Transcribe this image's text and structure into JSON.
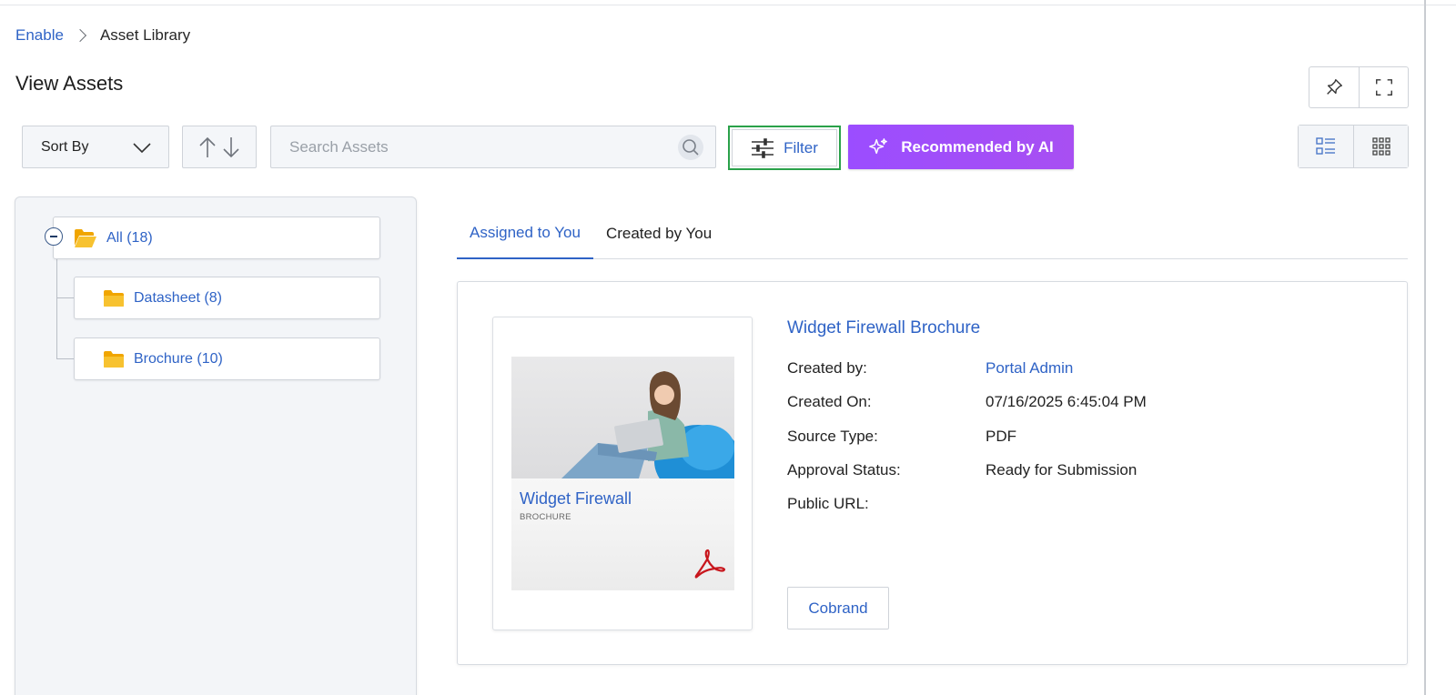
{
  "breadcrumb": {
    "root": "Enable",
    "current": "Asset Library"
  },
  "page": {
    "title": "View Assets"
  },
  "toolbar": {
    "sort_label": "Sort By",
    "search_placeholder": "Search Assets",
    "filter_label": "Filter",
    "ai_label": "Recommended by AI"
  },
  "tree": {
    "all": "All (18)",
    "items": [
      {
        "label": "Datasheet (8)"
      },
      {
        "label": "Brochure (10)"
      }
    ]
  },
  "tabs": [
    {
      "label": "Assigned to You",
      "active": true
    },
    {
      "label": "Created by You",
      "active": false
    }
  ],
  "asset": {
    "name": "Widget Firewall Brochure",
    "thumb_title": "Widget Firewall",
    "thumb_subtitle": "BROCHURE",
    "fields": [
      {
        "label": "Created by:",
        "value": "Portal Admin"
      },
      {
        "label": "Created On:",
        "value": "07/16/2025 6:45:04 PM"
      },
      {
        "label": "Source Type:",
        "value": "PDF"
      },
      {
        "label": "Approval Status:",
        "value": "Ready for Submission"
      },
      {
        "label": "Public URL:",
        "value": ""
      }
    ],
    "cobrand_label": "Cobrand"
  },
  "colors": {
    "link": "#2f63c6",
    "ai_button": "#9b4dff",
    "filter_highlight": "#2aa14a",
    "folder": "#f5b400"
  }
}
